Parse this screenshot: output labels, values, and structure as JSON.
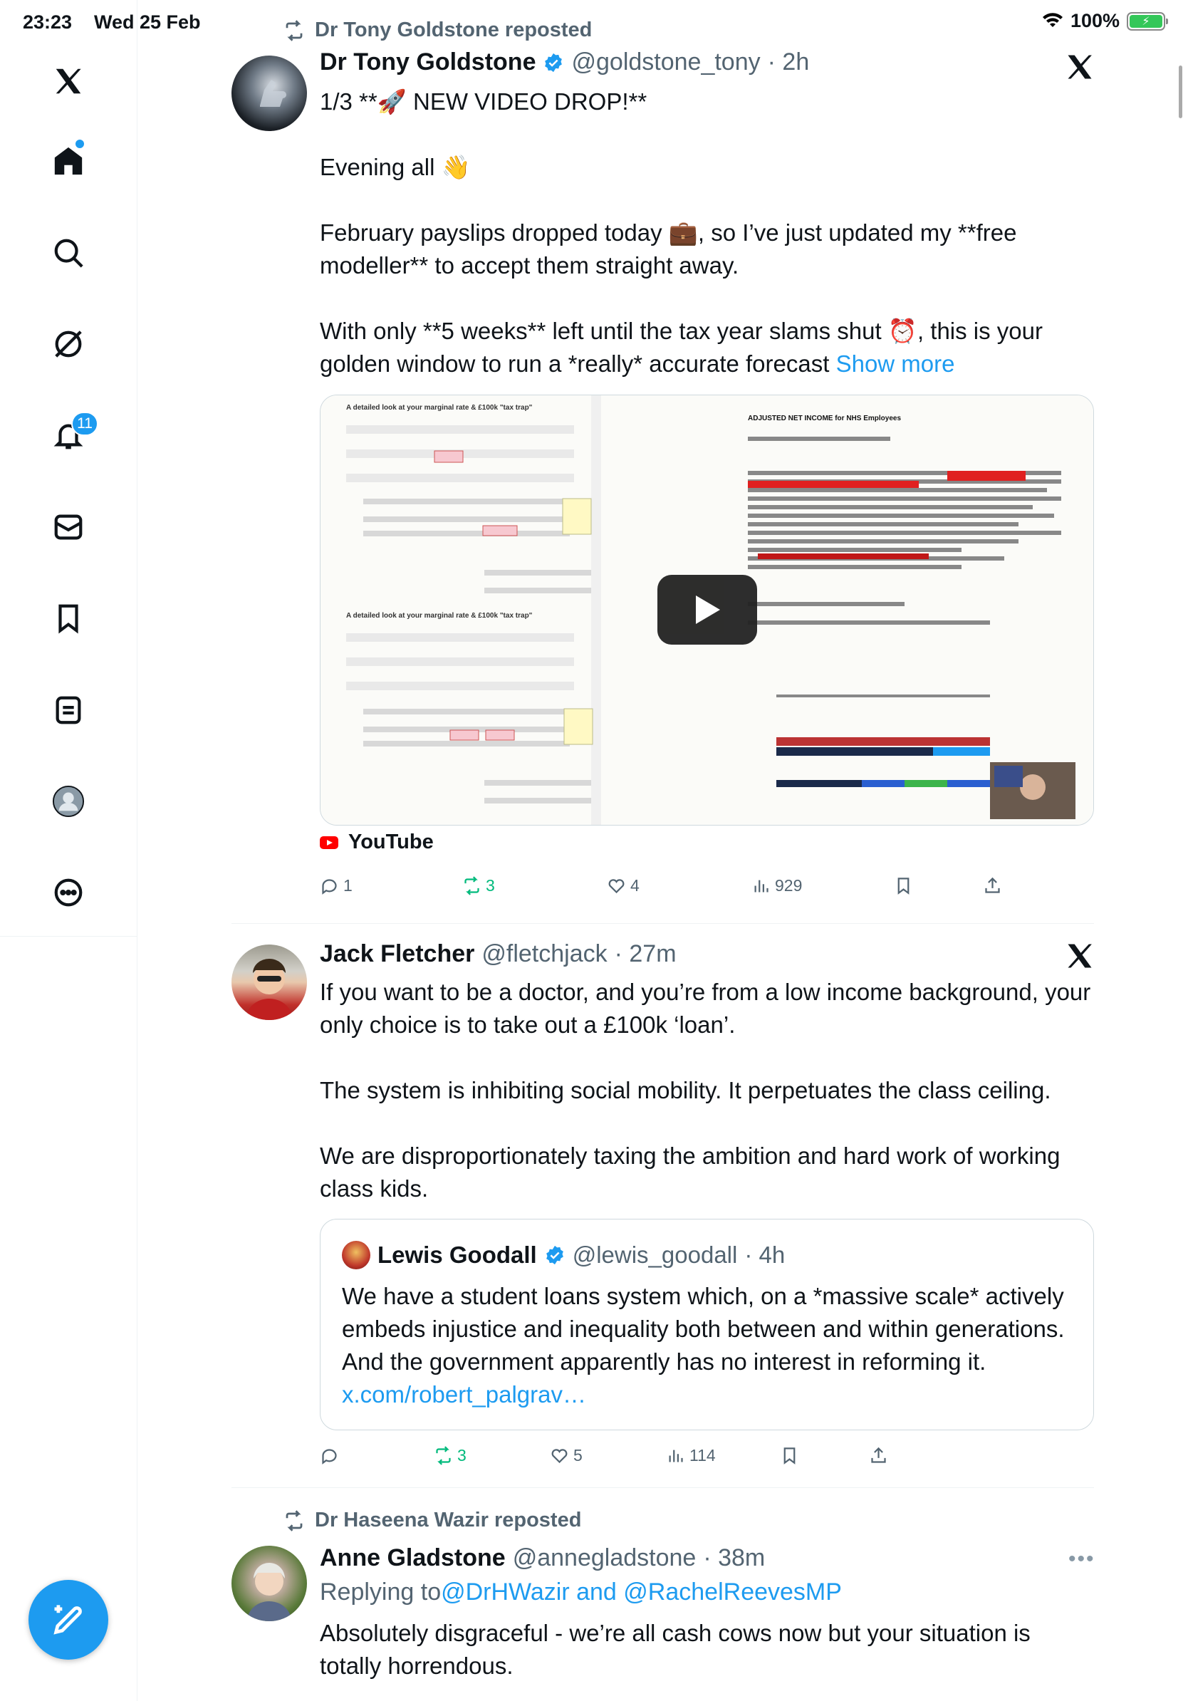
{
  "status_bar": {
    "time": "23:23",
    "date": "Wed 25 Feb",
    "battery": "100%"
  },
  "sidebar": {
    "items": [
      "x-logo",
      "home",
      "explore",
      "grok",
      "notifications",
      "messages",
      "bookmarks",
      "lists",
      "profile",
      "more"
    ],
    "notification_count": "11"
  },
  "tweets": [
    {
      "repost_by": "Dr Tony Goldstone reposted",
      "name": "Dr Tony Goldstone",
      "handle": "@goldstone_tony",
      "time": "· 2h",
      "text": "1/3 **🚀 NEW VIDEO DROP!**\n\nEvening all 👋\n\nFebruary payslips dropped today 💼, so I’ve just updated my **free modeller** to accept them straight away.\n\nWith only **5 weeks** left until the tax year slams shut ⏰, this is your golden window to run a *really* accurate forecast ",
      "show_more": "Show more",
      "media_source": "YouTube",
      "media_titles": [
        "A detailed look at your marginal rate & £100k \"tax trap\"",
        "ADJUSTED NET INCOME for NHS Employees"
      ],
      "replies": "1",
      "reposts": "3",
      "likes": "4",
      "views": "929"
    },
    {
      "name": "Jack Fletcher",
      "handle": "@fletchjack",
      "time": "· 27m",
      "text": "If you want to be a doctor, and you’re from a low income background, your only choice is to take out a £100k ‘loan’.\n\nThe system is inhibiting social mobility. It perpetuates the class ceiling.\n\nWe are disproportionately taxing the ambition and hard work of working class kids.",
      "quote": {
        "name": "Lewis Goodall",
        "handle": "@lewis_goodall",
        "time": "· 4h",
        "text": "We have a student loans system which, on a *massive scale* actively embeds injustice and inequality both between and within generations. And the government apparently has no interest in reforming it. ",
        "link": "x.com/robert_palgrav…"
      },
      "replies": "",
      "reposts": "3",
      "likes": "5",
      "views": "114"
    },
    {
      "repost_by": "Dr Haseena Wazir reposted",
      "name": "Anne Gladstone",
      "handle": "@annegladstone",
      "time": "· 38m",
      "replying_label": "Replying to ",
      "replying_to": "@DrHWazir and @RachelReevesMP",
      "text": "Absolutely disgraceful - we’re all cash cows now but your situation is totally horrendous."
    }
  ],
  "colors": {
    "accent": "#1d9bf0",
    "repost_green": "#00ba7c",
    "muted": "#536471"
  }
}
